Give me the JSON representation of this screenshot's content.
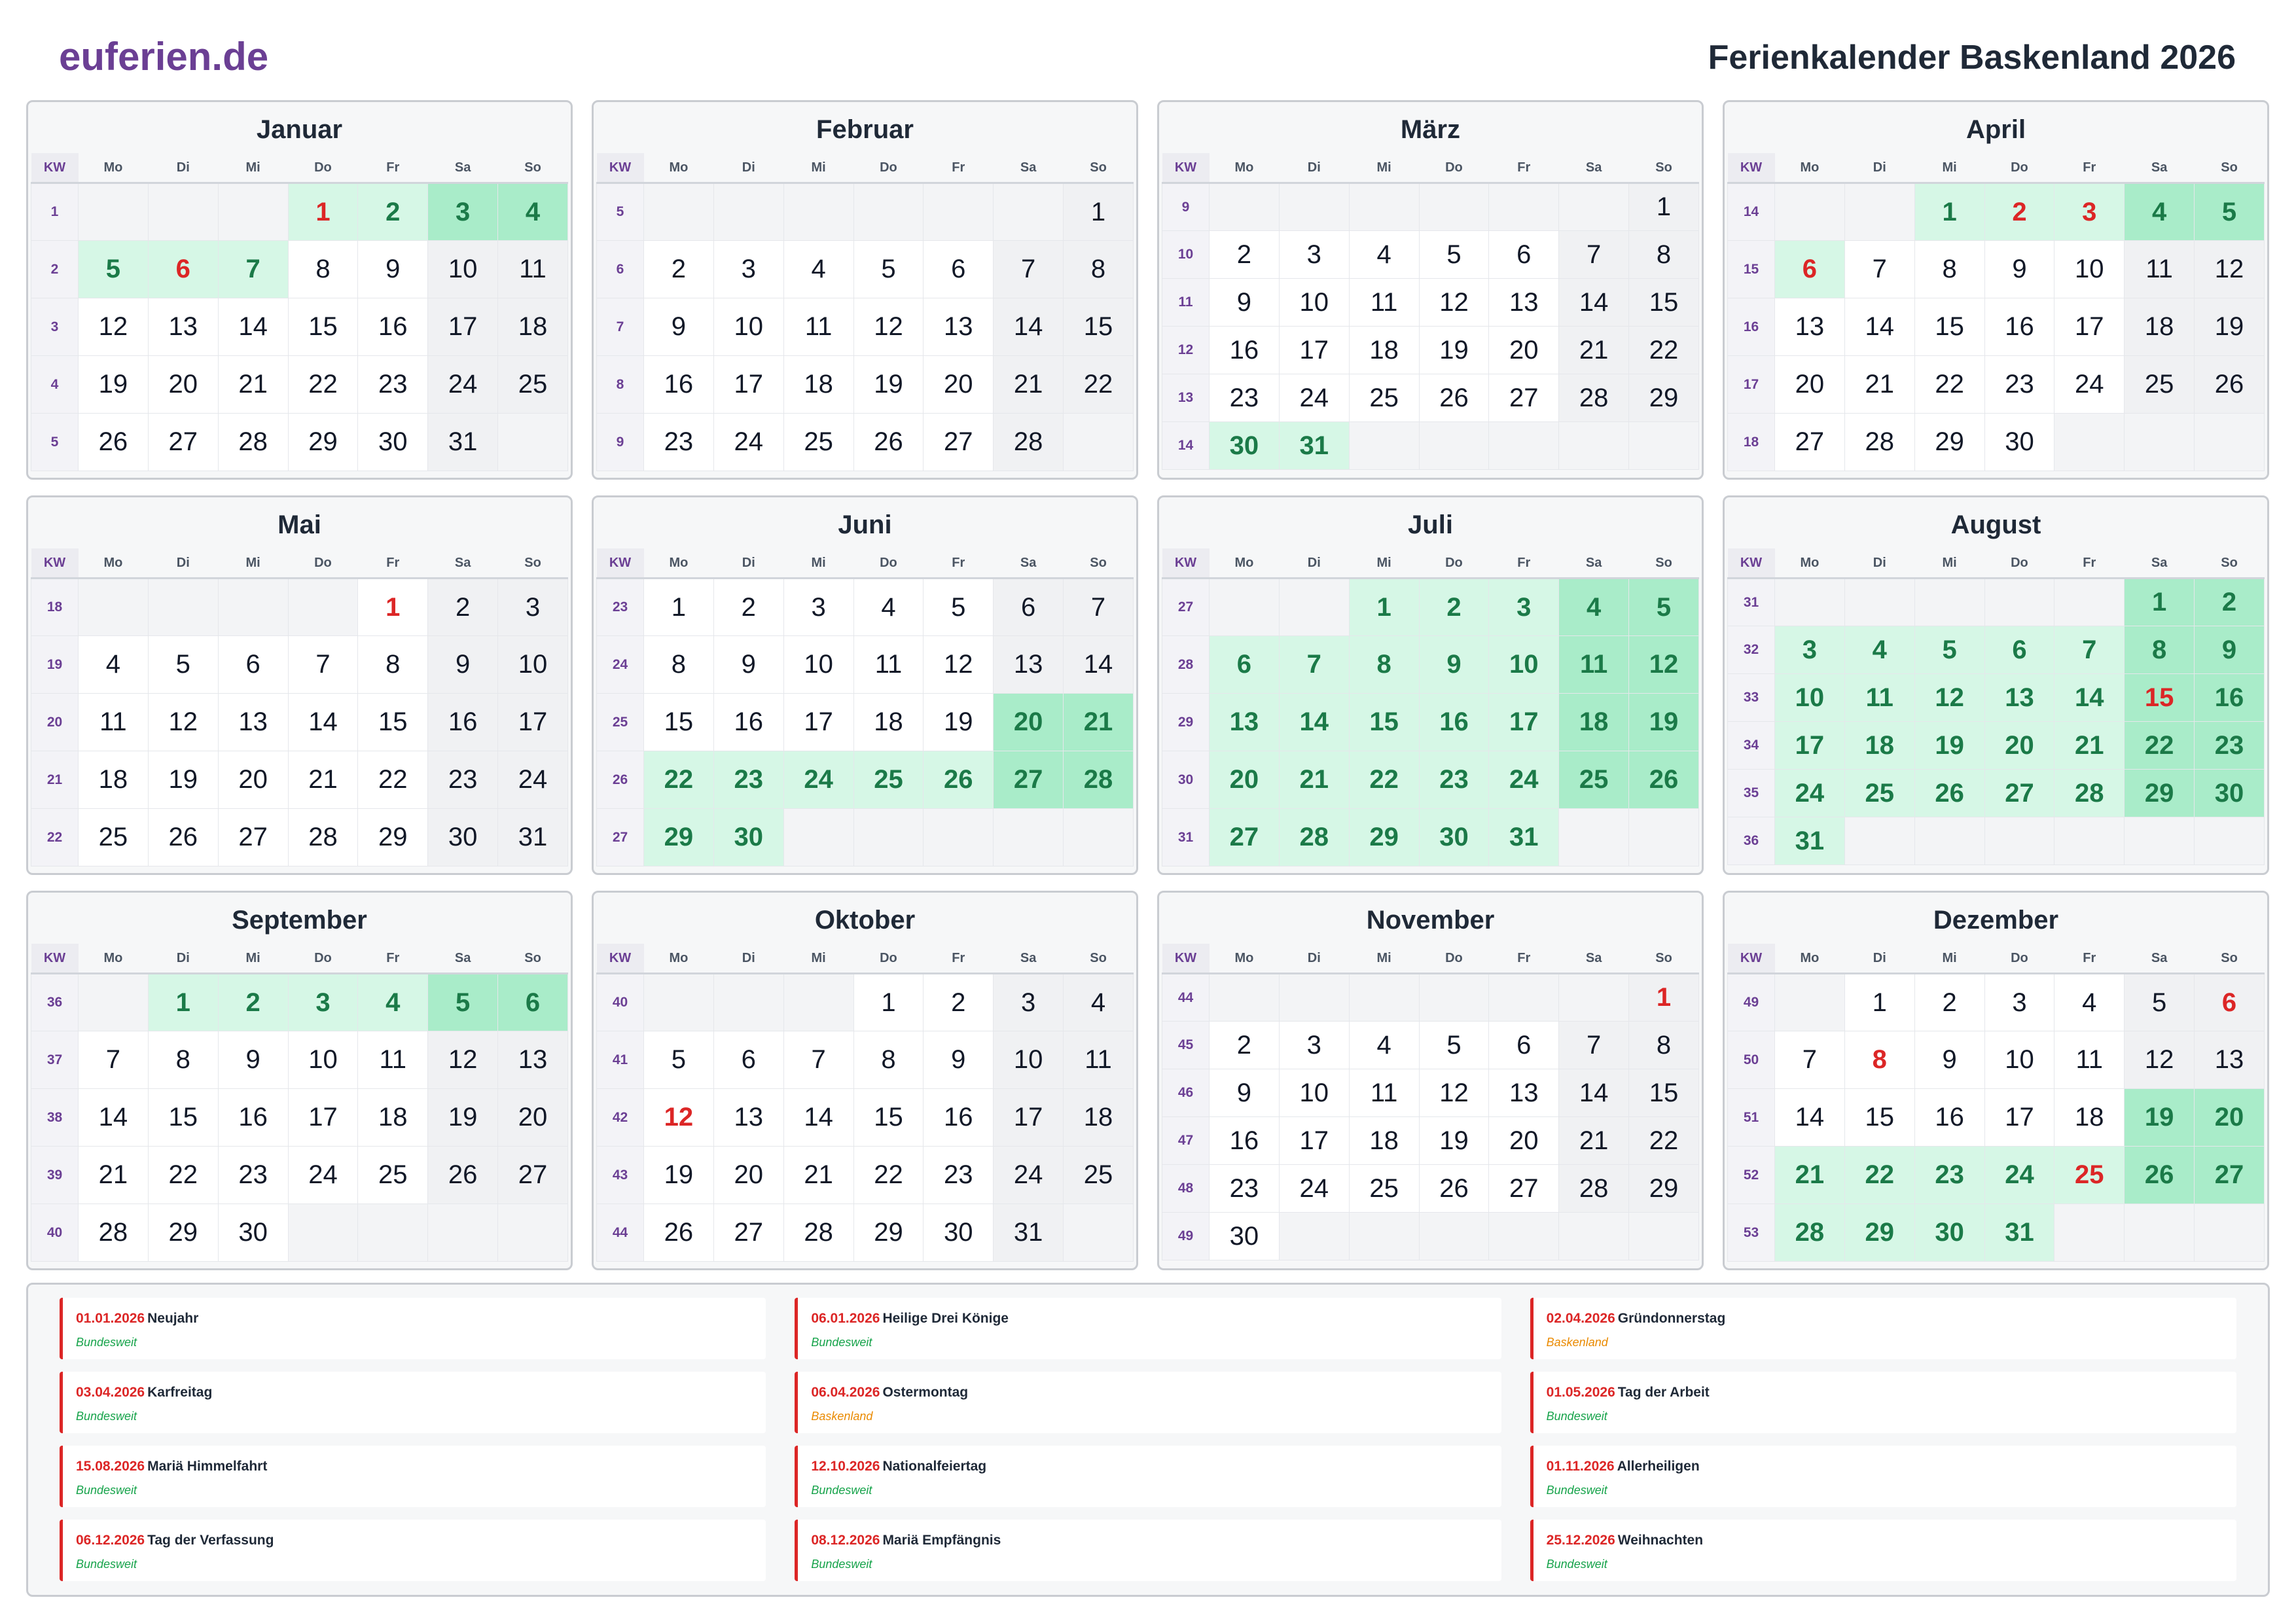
{
  "header": {
    "logo": "euferien.de",
    "title": "Ferienkalender Baskenland 2026"
  },
  "kw_label": "KW",
  "weekdays": [
    "Mo",
    "Di",
    "Mi",
    "Do",
    "Fr",
    "Sa",
    "So"
  ],
  "months": [
    {
      "name": "Januar",
      "offset": 3,
      "days": 31,
      "kw": [
        1,
        2,
        3,
        4,
        5
      ],
      "holidays": [
        1,
        2,
        3,
        4,
        5,
        6,
        7
      ],
      "public": [
        1,
        6
      ]
    },
    {
      "name": "Februar",
      "offset": 6,
      "days": 28,
      "kw": [
        5,
        6,
        7,
        8,
        9
      ],
      "holidays": [],
      "public": []
    },
    {
      "name": "März",
      "offset": 6,
      "days": 31,
      "kw": [
        9,
        10,
        11,
        12,
        13,
        14
      ],
      "holidays": [
        30,
        31
      ],
      "public": []
    },
    {
      "name": "April",
      "offset": 2,
      "days": 30,
      "kw": [
        14,
        15,
        16,
        17,
        18
      ],
      "holidays": [
        1,
        2,
        3,
        4,
        5,
        6
      ],
      "public": [
        2,
        3,
        6
      ]
    },
    {
      "name": "Mai",
      "offset": 4,
      "days": 31,
      "kw": [
        18,
        19,
        20,
        21,
        22
      ],
      "holidays": [],
      "public": [
        1
      ]
    },
    {
      "name": "Juni",
      "offset": 0,
      "days": 30,
      "kw": [
        23,
        24,
        25,
        26,
        27
      ],
      "holidays": [
        20,
        21,
        22,
        23,
        24,
        25,
        26,
        27,
        28,
        29,
        30
      ],
      "public": []
    },
    {
      "name": "Juli",
      "offset": 2,
      "days": 31,
      "kw": [
        27,
        28,
        29,
        30,
        31
      ],
      "holidays": [
        1,
        2,
        3,
        4,
        5,
        6,
        7,
        8,
        9,
        10,
        11,
        12,
        13,
        14,
        15,
        16,
        17,
        18,
        19,
        20,
        21,
        22,
        23,
        24,
        25,
        26,
        27,
        28,
        29,
        30,
        31
      ],
      "public": []
    },
    {
      "name": "August",
      "offset": 5,
      "days": 31,
      "kw": [
        31,
        32,
        33,
        34,
        35,
        36
      ],
      "holidays": [
        1,
        2,
        3,
        4,
        5,
        6,
        7,
        8,
        9,
        10,
        11,
        12,
        13,
        14,
        15,
        16,
        17,
        18,
        19,
        20,
        21,
        22,
        23,
        24,
        25,
        26,
        27,
        28,
        29,
        30,
        31
      ],
      "public": [
        15
      ]
    },
    {
      "name": "September",
      "offset": 1,
      "days": 30,
      "kw": [
        36,
        37,
        38,
        39,
        40
      ],
      "holidays": [
        1,
        2,
        3,
        4,
        5,
        6
      ],
      "public": []
    },
    {
      "name": "Oktober",
      "offset": 3,
      "days": 31,
      "kw": [
        40,
        41,
        42,
        43,
        44
      ],
      "holidays": [],
      "public": [
        12
      ]
    },
    {
      "name": "November",
      "offset": 6,
      "days": 30,
      "kw": [
        44,
        45,
        46,
        47,
        48,
        49
      ],
      "holidays": [],
      "public": [
        1
      ]
    },
    {
      "name": "Dezember",
      "offset": 1,
      "days": 31,
      "kw": [
        49,
        50,
        51,
        52,
        53
      ],
      "holidays": [
        19,
        20,
        21,
        22,
        23,
        24,
        25,
        26,
        27,
        28,
        29,
        30,
        31
      ],
      "public": [
        6,
        8,
        25
      ]
    }
  ],
  "legend": [
    {
      "date": "01.01.2026",
      "name": "Neujahr",
      "region": "Bundesweit",
      "type": "national"
    },
    {
      "date": "06.01.2026",
      "name": "Heilige Drei Könige",
      "region": "Bundesweit",
      "type": "national"
    },
    {
      "date": "02.04.2026",
      "name": "Gründonnerstag",
      "region": "Baskenland",
      "type": "regional"
    },
    {
      "date": "03.04.2026",
      "name": "Karfreitag",
      "region": "Bundesweit",
      "type": "national"
    },
    {
      "date": "06.04.2026",
      "name": "Ostermontag",
      "region": "Baskenland",
      "type": "regional"
    },
    {
      "date": "01.05.2026",
      "name": "Tag der Arbeit",
      "region": "Bundesweit",
      "type": "national"
    },
    {
      "date": "15.08.2026",
      "name": "Mariä Himmelfahrt",
      "region": "Bundesweit",
      "type": "national"
    },
    {
      "date": "12.10.2026",
      "name": "Nationalfeiertag",
      "region": "Bundesweit",
      "type": "national"
    },
    {
      "date": "01.11.2026",
      "name": "Allerheiligen",
      "region": "Bundesweit",
      "type": "national"
    },
    {
      "date": "06.12.2026",
      "name": "Tag der Verfassung",
      "region": "Bundesweit",
      "type": "national"
    },
    {
      "date": "08.12.2026",
      "name": "Mariä Empfängnis",
      "region": "Bundesweit",
      "type": "national"
    },
    {
      "date": "25.12.2026",
      "name": "Weihnachten",
      "region": "Bundesweit",
      "type": "national"
    }
  ]
}
